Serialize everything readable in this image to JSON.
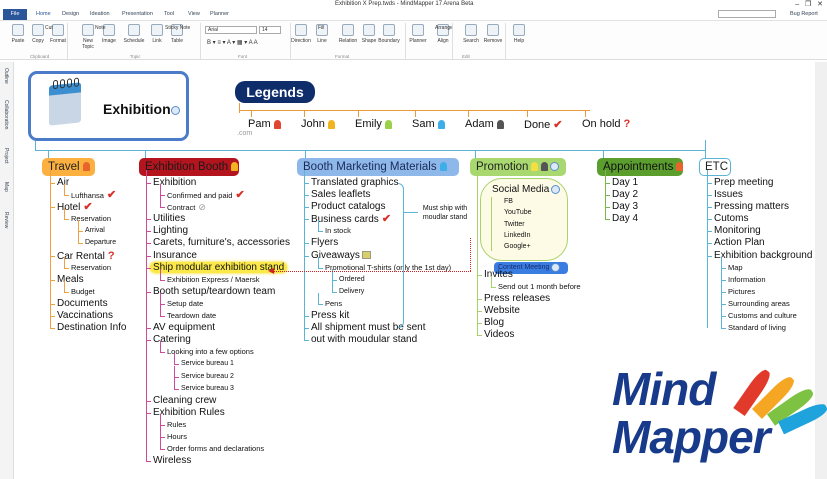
{
  "window": {
    "title": "Exhibition X Prep.twds - MindMapper 17 Arena Beta",
    "bug_report": "Bug Report"
  },
  "tabs": [
    "File",
    "Home",
    "Design",
    "Ideation",
    "Presentation",
    "Tool",
    "View",
    "Planner"
  ],
  "ribbon": {
    "buttons": [
      "Paste",
      "Copy",
      "Format",
      "New Topic",
      "Image",
      "Schedule",
      "Link",
      "Table",
      "Direction",
      "Line",
      "Relation",
      "Shape",
      "Boundary",
      "Planner",
      "Align",
      "Search",
      "Remove",
      "Help"
    ],
    "small": {
      "cut": "Cut",
      "note": "Note",
      "sticky": "Sticky Note",
      "fill": "Fill",
      "arrange": "Arrange"
    },
    "font": "Arial",
    "font_size": "14",
    "groups": [
      "Clipboard",
      "Topic",
      "Font",
      "Format",
      "Edit"
    ]
  },
  "left_panel": [
    "Outline",
    "Collaboration",
    "Project",
    "Map",
    "Review"
  ],
  "central": {
    "label": "Exhibition"
  },
  "legends": {
    "title": "Legends",
    "items": [
      {
        "label": "Pam",
        "icon": "person",
        "color": "#e0452f"
      },
      {
        "label": "John",
        "icon": "person",
        "color": "#f2b320"
      },
      {
        "label": "Emily",
        "icon": "person",
        "color": "#9bd14a"
      },
      {
        "label": "Sam",
        "icon": "person",
        "color": "#3eaee8"
      },
      {
        "label": "Adam",
        "icon": "person",
        "color": "#555555"
      },
      {
        "label": "Done",
        "icon": "check"
      },
      {
        "label": "On hold",
        "icon": "question"
      }
    ],
    "watermark": ".com"
  },
  "branches": [
    {
      "title": "Travel",
      "fill": "#fbb040",
      "text": "#222",
      "line": "#f0a040",
      "items": [
        {
          "t": "Air",
          "l": 1
        },
        {
          "t": "Lufthansa",
          "l": 2,
          "icon": "check"
        },
        {
          "t": "Hotel",
          "l": 1,
          "icon": "check"
        },
        {
          "t": "Reservation",
          "l": 2
        },
        {
          "t": "Arrival",
          "l": 3
        },
        {
          "t": "Departure",
          "l": 3
        },
        {
          "t": "Car Rental",
          "l": 1,
          "icon": "question"
        },
        {
          "t": "Reservation",
          "l": 2
        },
        {
          "t": "Meals",
          "l": 1
        },
        {
          "t": "Budget",
          "l": 2
        },
        {
          "t": "Documents",
          "l": 1
        },
        {
          "t": "Vaccinations",
          "l": 1
        },
        {
          "t": "Destination Info",
          "l": 1
        }
      ]
    },
    {
      "title": "Exhibition Booth",
      "fill": "#b3141e",
      "text": "#1a1a1a",
      "line": "#d04a9a",
      "items": [
        {
          "t": "Exhibition",
          "l": 1
        },
        {
          "t": "Confirmed and paid",
          "l": 2,
          "icon": "check"
        },
        {
          "t": "Contract",
          "l": 2,
          "icon": "clip"
        },
        {
          "t": "Utilities",
          "l": 1
        },
        {
          "t": "Lighting",
          "l": 1
        },
        {
          "t": "Carets, furniture's, accessories",
          "l": 1
        },
        {
          "t": "Insurance",
          "l": 1
        },
        {
          "t": "Ship modular exhibition stand",
          "l": 1,
          "hl": true
        },
        {
          "t": "Exhibition Express / Maersk",
          "l": 2
        },
        {
          "t": "Booth setup/teardown team",
          "l": 1
        },
        {
          "t": "Setup date",
          "l": 2
        },
        {
          "t": "Teardown date",
          "l": 2
        },
        {
          "t": "AV  equipment",
          "l": 1
        },
        {
          "t": "Catering",
          "l": 1
        },
        {
          "t": "Looking into a few options",
          "l": 2
        },
        {
          "t": "Service bureau 1",
          "l": 3
        },
        {
          "t": "Service bureau 2",
          "l": 3
        },
        {
          "t": "Service bureau 3",
          "l": 3
        },
        {
          "t": "Cleaning crew",
          "l": 1
        },
        {
          "t": "Exhibition Rules",
          "l": 1
        },
        {
          "t": "Rules",
          "l": 2
        },
        {
          "t": "Hours",
          "l": 2
        },
        {
          "t": "Order forms and declarations",
          "l": 2
        },
        {
          "t": "Wireless",
          "l": 1
        }
      ]
    },
    {
      "title": "Booth Marketing Materials",
      "fill": "#8fb8ea",
      "text": "#1a2b5a",
      "line": "#5bb3d6",
      "items": [
        {
          "t": "Translated graphics",
          "l": 1
        },
        {
          "t": "Sales leaflets",
          "l": 1
        },
        {
          "t": "Product catalogs",
          "l": 1
        },
        {
          "t": "Business cards",
          "l": 1,
          "icon": "check"
        },
        {
          "t": "In stock",
          "l": 2
        },
        {
          "t": "Flyers",
          "l": 1
        },
        {
          "t": "Giveaways",
          "l": 1,
          "icon": "note"
        },
        {
          "t": "Promotional T-shirts (only the 1st day)",
          "l": 2
        },
        {
          "t": "Ordered",
          "l": 3
        },
        {
          "t": "Delivery",
          "l": 3
        },
        {
          "t": "Pens",
          "l": 2
        },
        {
          "t": "Press kit",
          "l": 1
        },
        {
          "t": "All shipment must be sent",
          "l": 1
        },
        {
          "t": "out with moudular stand",
          "l": 1
        }
      ]
    },
    {
      "title": "Promotion",
      "fill": "#a9d870",
      "text": "#222",
      "line": "#a6d36a",
      "social": {
        "title": "Social Media",
        "items": [
          "FB",
          "YouTube",
          "Twitter",
          "LinkedIn",
          "Google+"
        ]
      },
      "meeting": "Content Meeting",
      "items": [
        {
          "t": "Invites",
          "l": 1
        },
        {
          "t": "Send out 1 month before",
          "l": 2
        },
        {
          "t": "Press releases",
          "l": 1
        },
        {
          "t": "Website",
          "l": 1
        },
        {
          "t": "Blog",
          "l": 1
        },
        {
          "t": "Videos",
          "l": 1
        }
      ]
    },
    {
      "title": "Appointments",
      "fill": "#5c9e2e",
      "text": "#111",
      "line": "#7bb84a",
      "items": [
        {
          "t": "Day 1",
          "l": 1
        },
        {
          "t": "Day 2",
          "l": 1
        },
        {
          "t": "Day 3",
          "l": 1
        },
        {
          "t": "Day 4",
          "l": 1
        }
      ]
    },
    {
      "title": "ETC",
      "fill": "#ffffff",
      "text": "#222",
      "line": "#5bb3d6",
      "items": [
        {
          "t": "Prep meeting",
          "l": 1
        },
        {
          "t": "Issues",
          "l": 1
        },
        {
          "t": "Pressing matters",
          "l": 1
        },
        {
          "t": "Cutoms",
          "l": 1
        },
        {
          "t": "Monitoring",
          "l": 1
        },
        {
          "t": "Action Plan",
          "l": 1
        },
        {
          "t": "Exhibition background",
          "l": 1
        },
        {
          "t": "Map",
          "l": 2
        },
        {
          "t": "Information",
          "l": 2
        },
        {
          "t": "Pictures",
          "l": 2
        },
        {
          "t": "Surrounding areas",
          "l": 2
        },
        {
          "t": "Customs and culture",
          "l": 2
        },
        {
          "t": "Standard of living",
          "l": 2
        }
      ]
    }
  ],
  "note": "Must ship with moudlar stand",
  "logo": {
    "line1": "Mind",
    "line2": "Mapper"
  }
}
